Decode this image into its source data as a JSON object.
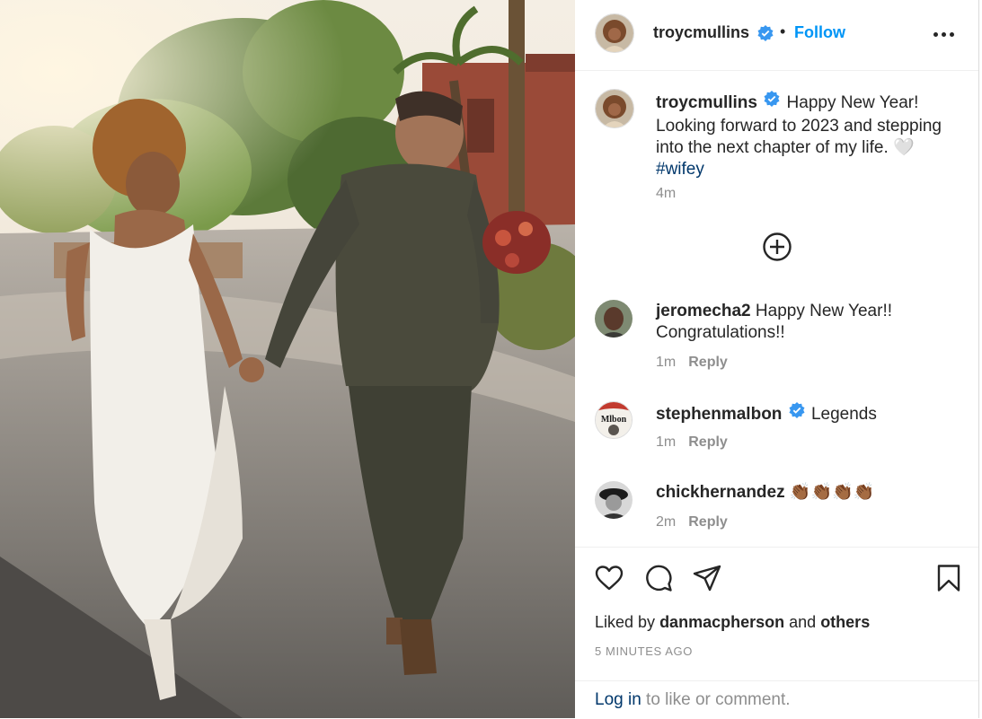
{
  "post": {
    "author": "troycmullins",
    "follow_label": "Follow",
    "separator": "•"
  },
  "caption": {
    "username": "troycmullins",
    "text_before": "Happy New Year! Looking forward to 2023 and stepping into the next chapter of my life. 🤍 ",
    "hashtag": "#wifey",
    "time": "4m"
  },
  "comments": [
    {
      "username": "jeromecha2",
      "text": "Happy New Year!! Congratulations!!",
      "time": "1m",
      "reply_label": "Reply",
      "verified": false
    },
    {
      "username": "stephenmalbon",
      "text": "Legends",
      "time": "1m",
      "reply_label": "Reply",
      "verified": true
    },
    {
      "username": "chickhernandez",
      "text": "👏🏾👏🏾👏🏾👏🏾",
      "time": "2m",
      "reply_label": "Reply",
      "verified": false
    }
  ],
  "likes": {
    "prefix": "Liked by",
    "user": "danmacpherson",
    "middle": "and",
    "others": "others"
  },
  "timestamp": "5 MINUTES AGO",
  "login": {
    "link": "Log in",
    "rest": " to like or comment."
  },
  "colors": {
    "accent": "#0095f6",
    "link": "#00376b",
    "muted": "#8e8e8e",
    "verified": "#3897f0"
  },
  "icons": [
    "verified-badge-icon",
    "more-options-icon",
    "load-more-plus-icon",
    "heart-icon",
    "comment-icon",
    "share-icon",
    "bookmark-icon"
  ]
}
